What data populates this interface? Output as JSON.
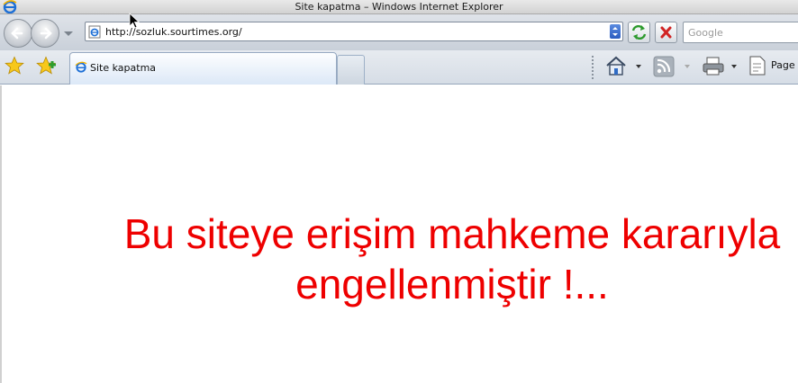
{
  "window": {
    "title": "Site kapatma – Windows Internet Explorer"
  },
  "address_bar": {
    "url": "http://sozluk.sourtimes.org/"
  },
  "search": {
    "placeholder": "Google"
  },
  "tabs": [
    {
      "label": "Site kapatma",
      "active": true
    }
  ],
  "command_bar": {
    "page_label": "Page"
  },
  "content": {
    "message_line1": "Bu siteye erişim mahkeme kararıyla",
    "message_line2": "engellenmiştir !...",
    "message_color": "#ee0000"
  },
  "icons": {
    "app": "ie-logo-icon",
    "back": "back-arrow-icon",
    "forward": "forward-arrow-icon",
    "refresh": "refresh-icon",
    "stop": "stop-icon",
    "favorites": "star-icon",
    "add_favorites": "add-favorites-icon",
    "home": "home-icon",
    "feeds": "rss-feed-icon",
    "print": "printer-icon",
    "page": "page-icon"
  }
}
